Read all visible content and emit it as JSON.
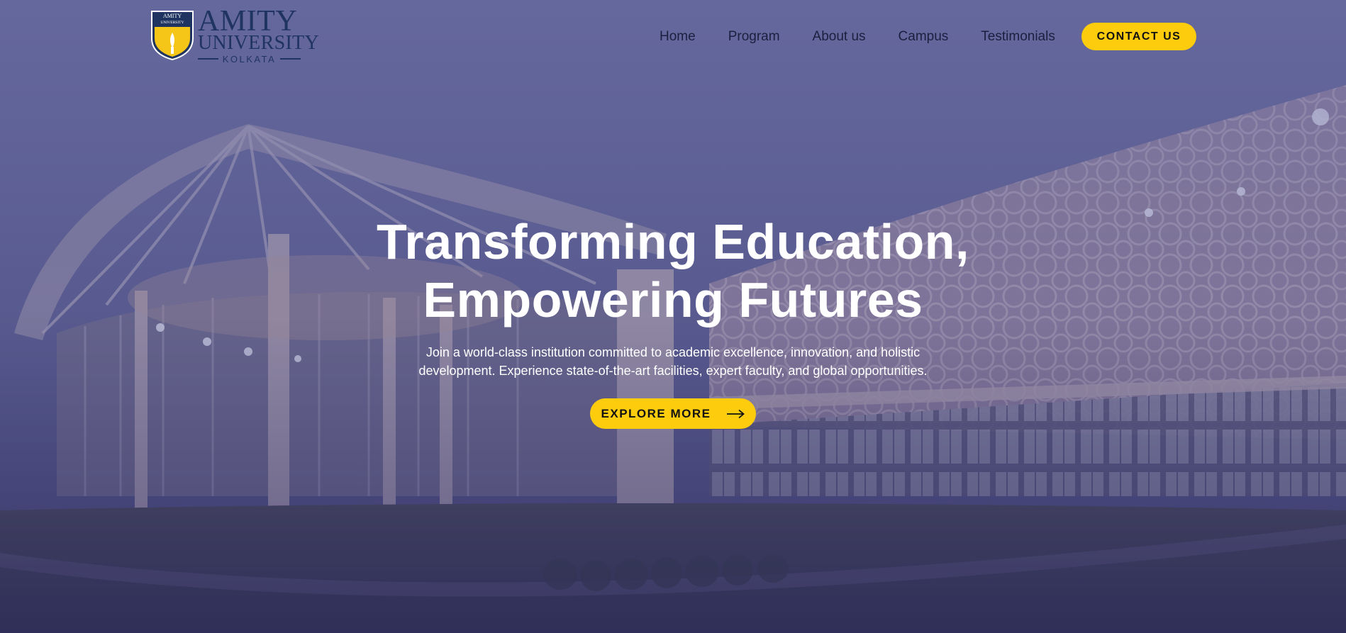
{
  "brand": {
    "logo_line1": "AMITY",
    "logo_line2": "UNIVERSITY",
    "logo_line3": "KOLKATA",
    "shield_text_1": "AMITY",
    "shield_text_2": "UNIVERSITY",
    "colors": {
      "navy": "#1f3461",
      "gold": "#fdcc0d"
    }
  },
  "nav": {
    "items": [
      {
        "label": "Home"
      },
      {
        "label": "Program"
      },
      {
        "label": "About us"
      },
      {
        "label": "Campus"
      },
      {
        "label": "Testimonials"
      }
    ],
    "contact_label": "CONTACT US"
  },
  "hero": {
    "title_line1": "Transforming Education,",
    "title_line2": "Empowering Futures",
    "subtitle": "Join a world-class institution committed to academic excellence, innovation, and holistic development. Experience state-of-the-art facilities, expert faculty, and global opportunities.",
    "cta_label": "EXPLORE MORE",
    "cta_icon": "arrow-right-icon",
    "background": "campus-building-photo"
  }
}
